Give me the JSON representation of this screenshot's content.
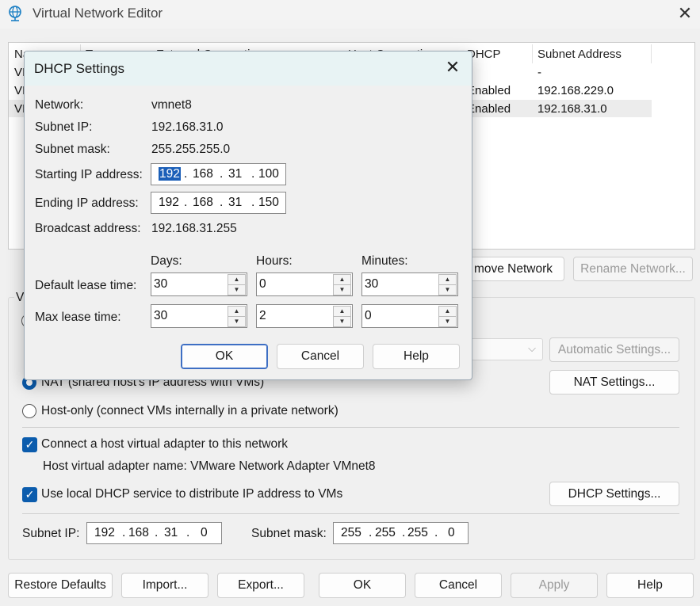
{
  "window": {
    "title": "Virtual Network Editor",
    "close": "✕"
  },
  "net_list": {
    "headers": [
      "Na",
      "Ty",
      "External Connection",
      "Host Connection",
      "DHCP",
      "Subnet Address"
    ],
    "rows": [
      {
        "name": "VI",
        "dhcp": "",
        "subnet": "-"
      },
      {
        "name": "VI",
        "dhcp": "Enabled",
        "subnet": "192.168.229.0"
      },
      {
        "name": "VI",
        "dhcp": "Enabled",
        "subnet": "192.168.31.0"
      }
    ]
  },
  "net_buttons": {
    "remove": "move Network",
    "rename": "Rename Network..."
  },
  "vm_group": {
    "label_fragment": "VI",
    "automatic_settings": "Automatic Settings...",
    "nat_option": "NAT (shared host's IP address with VMs)",
    "nat_settings": "NAT Settings...",
    "hostonly_option": "Host-only (connect VMs internally in a private network)",
    "connect_adapter": "Connect a host virtual adapter to this network",
    "adapter_name": "Host virtual adapter name: VMware Network Adapter VMnet8",
    "use_dhcp": "Use local DHCP service to distribute IP address to VMs",
    "dhcp_settings": "DHCP Settings...",
    "subnet_ip_label": "Subnet IP:",
    "subnet_ip": [
      "192",
      "168",
      "31",
      "0"
    ],
    "subnet_mask_label": "Subnet mask:",
    "subnet_mask": [
      "255",
      "255",
      "255",
      "0"
    ]
  },
  "bottom_buttons": {
    "restore": "Restore Defaults",
    "import": "Import...",
    "export": "Export...",
    "ok": "OK",
    "cancel": "Cancel",
    "apply": "Apply",
    "help": "Help"
  },
  "dialog": {
    "title": "DHCP Settings",
    "close": "✕",
    "network_label": "Network:",
    "network": "vmnet8",
    "subnet_ip_label": "Subnet IP:",
    "subnet_ip": "192.168.31.0",
    "subnet_mask_label": "Subnet mask:",
    "subnet_mask": "255.255.255.0",
    "start_label": "Starting IP address:",
    "start_ip": [
      "192",
      "168",
      "31",
      "100"
    ],
    "end_label": "Ending IP address:",
    "end_ip": [
      "192",
      "168",
      "31",
      "150"
    ],
    "broadcast_label": "Broadcast address:",
    "broadcast": "192.168.31.255",
    "days_label": "Days:",
    "hours_label": "Hours:",
    "minutes_label": "Minutes:",
    "default_lease_label": "Default lease time:",
    "default_lease": {
      "days": "30",
      "hours": "0",
      "minutes": "30"
    },
    "max_lease_label": "Max lease time:",
    "max_lease": {
      "days": "30",
      "hours": "2",
      "minutes": "0"
    },
    "ok": "OK",
    "cancel": "Cancel",
    "help": "Help"
  },
  "colors": {
    "accent": "#0b5cad",
    "dialog_title_bg": "#e8f3f4",
    "selection": "#1b5fb8"
  },
  "icons": {
    "app": "globe-network-icon",
    "close": "close-icon",
    "spin_up": "arrow-up-icon",
    "spin_down": "arrow-down-icon",
    "dropdown": "chevron-down-icon",
    "check": "checkmark-icon"
  }
}
